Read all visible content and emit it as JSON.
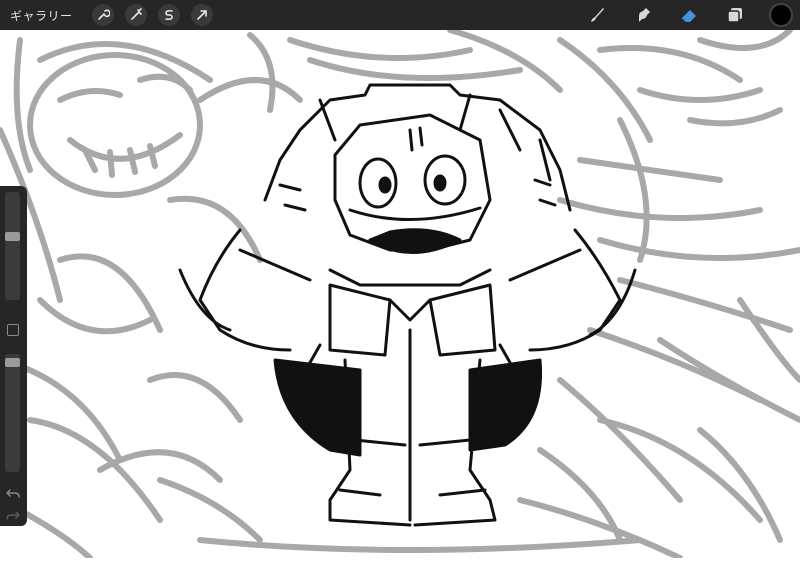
{
  "app": "Procreate",
  "toolbar": {
    "gallery_label": "ギャラリー",
    "left_tools": [
      "actions-wrench-icon",
      "adjustments-wand-icon",
      "selection-s-icon",
      "transform-arrow-icon"
    ],
    "right_tools": [
      "brush-icon",
      "smudge-icon",
      "eraser-icon",
      "layers-icon"
    ],
    "active_tool": "eraser",
    "active_tool_color": "#4a90e2",
    "current_color": "#000000"
  },
  "sidebar": {
    "brush_size": 0.65,
    "opacity": 1.0
  },
  "colors": {
    "sketch_gray": "#a8a8a8",
    "ink": "#111111",
    "ui_dark": "#262626"
  }
}
